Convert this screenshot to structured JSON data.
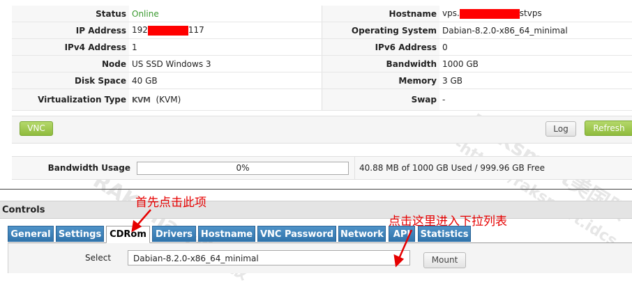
{
  "info": {
    "status_label": "Status",
    "status_value": "Online",
    "hostname_label": "Hostname",
    "hostname_prefix": "vps.",
    "hostname_suffix": "stvps",
    "ip_label": "IP Address",
    "ip_prefix": "192",
    "ip_suffix": "117",
    "os_label": "Operating System",
    "os_value": "Dabian-8.2.0-x86_64_minimal",
    "ipv4_label": "IPv4 Address",
    "ipv4_value": "1",
    "ipv6_label": "IPv6 Address",
    "ipv6_value": "0",
    "node_label": "Node",
    "node_value": "US SSD Windows 3",
    "bandwidth_label": "Bandwidth",
    "bandwidth_value": "1000 GB",
    "disk_label": "Disk Space",
    "disk_value": "40 GB",
    "memory_label": "Memory",
    "memory_value": "3 GB",
    "virt_label": "Virtualization Type",
    "virt_logo": "KVM",
    "virt_value": "(KVM)",
    "swap_label": "Swap",
    "swap_value": "-"
  },
  "actions": {
    "vnc": "VNC",
    "log": "Log",
    "refresh": "Refresh"
  },
  "bandwidth_usage": {
    "label": "Bandwidth Usage",
    "percent_text": "0%",
    "percent": 0,
    "summary": "40.88 MB of 1000 GB Used / 999.96 GB Free"
  },
  "controls": {
    "title": "Controls",
    "tabs": [
      "General",
      "Settings",
      "CDRom",
      "Drivers",
      "Hostname",
      "VNC Password",
      "Network",
      "API",
      "Statistics"
    ],
    "active_tab": "CDRom",
    "select_label": "Select",
    "select_value": "Dabian-8.2.0-x86_64_minimal",
    "mount_label": "Mount"
  },
  "annotations": {
    "first_click": "首先点击此项",
    "dropdown_hint": "点击这里进入下拉列表"
  },
  "watermark": {
    "brand": "RAKsmart美国服",
    "url": "-https://raksmart.idcs"
  },
  "colors": {
    "online": "#3a9a2f",
    "tab_blue": "#3a80bb",
    "green_button": "#8fbb3d",
    "annotation_red": "#e60000"
  }
}
